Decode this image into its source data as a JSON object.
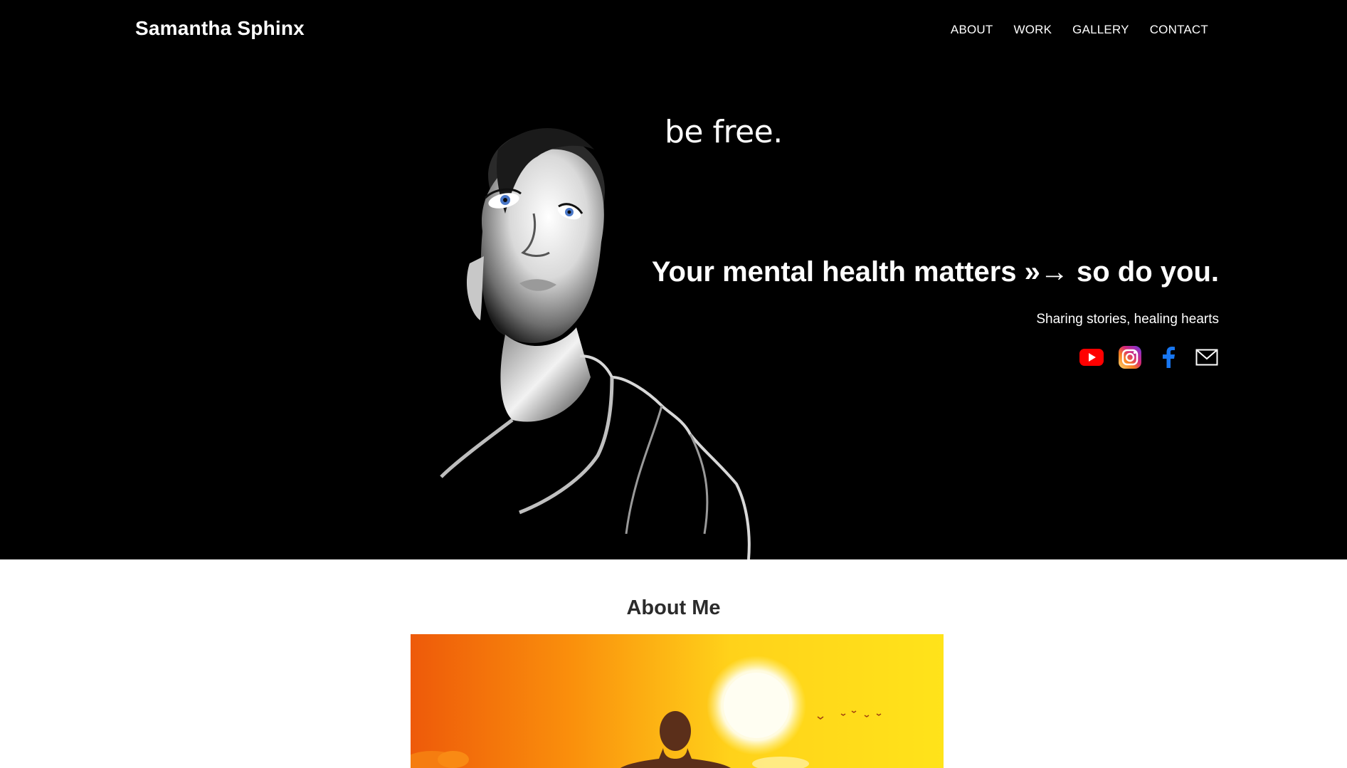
{
  "header": {
    "brand": "Samantha Sphinx",
    "nav": [
      "ABOUT",
      "WORK",
      "GALLERY",
      "CONTACT"
    ]
  },
  "hero": {
    "script_text": "be free.",
    "headline": "Your mental health matters »→ so do you.",
    "subline": "Sharing stories, healing hearts",
    "socials": [
      "youtube-icon",
      "instagram-icon",
      "facebook-icon",
      "mail-icon"
    ]
  },
  "about": {
    "title": "About Me"
  },
  "colors": {
    "hero_bg": "#000000",
    "youtube": "#ff0000",
    "facebook": "#1877f2",
    "about_title": "#2b2b2b"
  }
}
